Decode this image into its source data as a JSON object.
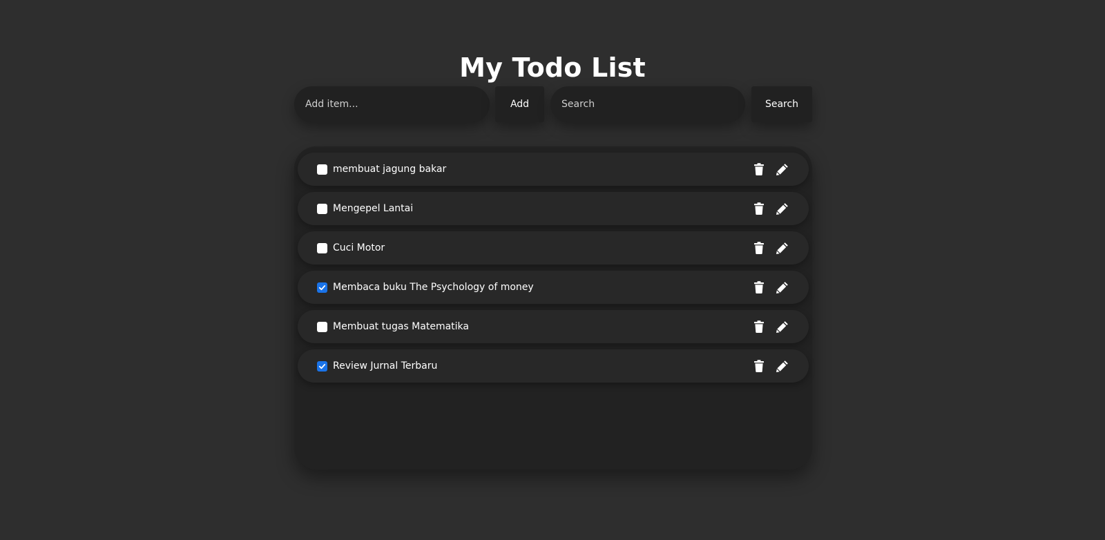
{
  "title": "My Todo List",
  "add_input": {
    "placeholder": "Add item...",
    "value": ""
  },
  "add_button_label": "Add",
  "search_input": {
    "placeholder": "Search",
    "value": ""
  },
  "search_button_label": "Search",
  "todos": [
    {
      "text": "membuat jagung bakar",
      "checked": false
    },
    {
      "text": "Mengepel Lantai",
      "checked": false
    },
    {
      "text": "Cuci Motor",
      "checked": false
    },
    {
      "text": "Membaca buku The Psychology of money",
      "checked": true
    },
    {
      "text": "Membuat tugas Matematika",
      "checked": false
    },
    {
      "text": "Review Jurnal Terbaru",
      "checked": true
    }
  ],
  "icons": {
    "delete": "trash-icon",
    "edit": "pencil-icon",
    "checked": "check-icon"
  },
  "colors": {
    "background": "#2e2e2e",
    "panel": "#222222",
    "item": "#282828",
    "checkbox_checked": "#1a73e8",
    "text": "#ffffff"
  }
}
